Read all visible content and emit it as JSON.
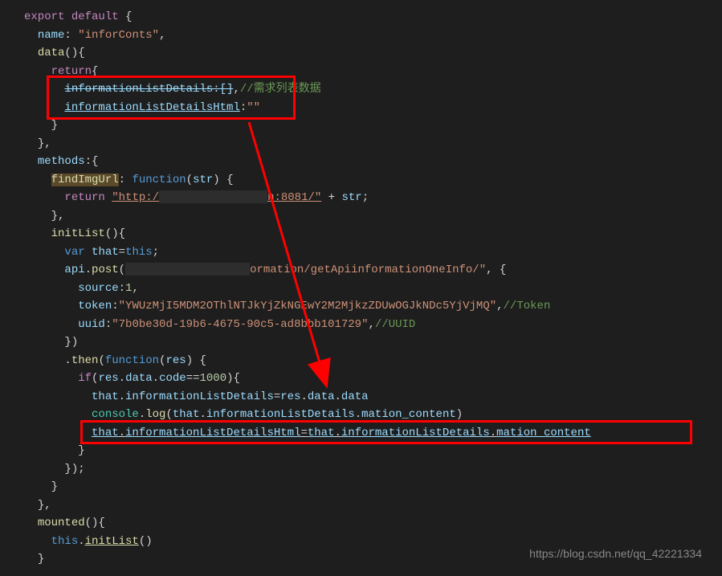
{
  "lines": {
    "l1_export": "export",
    "l1_default": " default",
    "l1_brace": " {",
    "l2_name": "name",
    "l2_colon": ": ",
    "l2_val": "\"inforConts\"",
    "l2_comma": ",",
    "l3_data": "data",
    "l3_paren": "(){",
    "l4_return": "return",
    "l4_brace": "{",
    "l5_prop": "informationListDetails:[]",
    "l5_comma": ",",
    "l5_comment": "//需求列表数据",
    "l6_prop": "informationListDetailsHtml",
    "l6_colon": ":",
    "l6_val": "\"\"",
    "l7": "}",
    "l8": "},",
    "l9_prop": "methods",
    "l9_colon": ":{",
    "l10_func": "findImgUrl",
    "l10_colon": ": ",
    "l10_funckw": "function",
    "l10_open": "(",
    "l10_param": "str",
    "l10_close": ") {",
    "l11_return": "return",
    "l11_space": " ",
    "l11_str1": "\"http:/",
    "l11_str2": "n:8081/\"",
    "l11_plus": " + ",
    "l11_str3": "str",
    "l11_semi": ";",
    "l12": "},",
    "l13_func": "initList",
    "l13_paren": "(){",
    "l14_var": "var",
    "l14_that": " that",
    "l14_eq": "=",
    "l14_this": "this",
    "l14_semi": ";",
    "l15_api": "api",
    "l15_dot": ".",
    "l15_post": "post",
    "l15_open": "(",
    "l15_str1": "ormation/getApiinformationOneInfo/\"",
    "l15_comma": ", {",
    "l16_prop": "source",
    "l16_colon": ":",
    "l16_val": "1",
    "l16_comma": ",",
    "l17_prop": "token",
    "l17_colon": ":",
    "l17_val": "\"YWUzMjI5MDM2OThlNTJkYjZkNGEwY2M2MjkzZDUwOGJkNDc5YjVjMQ\"",
    "l17_comma": ",",
    "l17_comment": "//Token",
    "l18_prop": "uuid",
    "l18_colon": ":",
    "l18_val": "\"7b0be30d-19b6-4675-90c5-ad8bbb101729\"",
    "l18_comma": ",",
    "l18_comment": "//UUID",
    "l19": "})",
    "l20_dot": ".",
    "l20_then": "then",
    "l20_open": "(",
    "l20_funckw": "function",
    "l20_popen": "(",
    "l20_param": "res",
    "l20_close": ") {",
    "l21_if": "if",
    "l21_open": "(",
    "l21_res": "res",
    "l21_dot1": ".",
    "l21_data": "data",
    "l21_dot2": ".",
    "l21_code": "code",
    "l21_eq": "==",
    "l21_val": "1000",
    "l21_close": "){",
    "l22_that": "that",
    "l22_dot1": ".",
    "l22_prop1": "informationListDetails",
    "l22_eq": "=",
    "l22_res": "res",
    "l22_dot2": ".",
    "l22_data1": "data",
    "l22_dot3": ".",
    "l22_data2": "data",
    "l23_console": "console",
    "l23_dot": ".",
    "l23_log": "log",
    "l23_open": "(",
    "l23_that": "that",
    "l23_dot1": ".",
    "l23_prop1": "informationListDetails",
    "l23_dot2": ".",
    "l23_prop2": "mation_content",
    "l23_close": ")",
    "l24_that": "that",
    "l24_dot1": ".",
    "l24_prop1": "informationListDetailsHtml",
    "l24_eq": "=",
    "l24_that2": "that",
    "l24_dot2": ".",
    "l24_prop2": "informationListDetails",
    "l24_dot3": ".",
    "l24_prop3": "mation_content",
    "l25": "}",
    "l26": "});",
    "l27": "}",
    "l28": "},",
    "l29_func": "mounted",
    "l29_paren": "(){",
    "l30_this": "this",
    "l30_dot": ".",
    "l30_func": "initList",
    "l30_paren": "()",
    "l31": "}"
  },
  "watermark": "https://blog.csdn.net/qq_42221334"
}
